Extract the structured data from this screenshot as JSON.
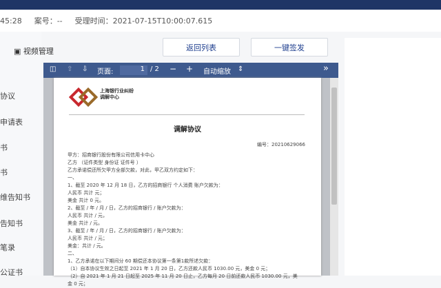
{
  "info": {
    "time_partial": "45:28",
    "case_no": "案号：--",
    "accept_time": "受理时间：2021-07-15T10:00:07.615"
  },
  "sidebar": {
    "video_label": "视频管理",
    "items": [
      "协议",
      "申请表",
      "书",
      "书",
      "维告知书",
      "告知书",
      "笔录",
      "公证书"
    ]
  },
  "buttons": {
    "back": "返回列表",
    "sign": "一键签发"
  },
  "toolbar": {
    "page_label": "页面:",
    "page_value": "1",
    "page_total": "/ 2",
    "zoom": "自动缩放",
    "minus": "−",
    "plus": "+",
    "more": "»"
  },
  "doc": {
    "logo_text": "上海银行业纠纷调解中心",
    "title": "调解协议",
    "number": "编号：20210629066",
    "lines": [
      "甲方：招商银行股份有限公司信用卡中心",
      "乙方            （证件类型    身份证 证件号                              ）",
      "乙方承诺偿还所欠甲方全部欠款，对此，甲乙双方约定如下：",
      "一、",
      "1、截至 2020 年 12 月 18 日，乙方的招商银行 个人消费 账户欠款为：",
      "人民币  共计        元；",
      "美金    共计    0     元。",
      "2、截至  /  年 / 月 / 日，乙方的招商银行     /     账户欠款为：",
      "人民币    共计     /      元，",
      "美金    共计     /     元。",
      "3、截至  /  年 / 月 / 日，乙方的招商银行     /     账户欠款为：",
      "人民币    共计     /     元；",
      "美金：共计     /    元。",
      "二、",
      "1、乙方承诺在以下期间分 60 期偿还本协议第一条第1款所述欠款：",
      "（1）自本协议生效之日起至 2021 年 1 月 20 日，乙方还款人民币  1030.00  元，美金  0 元；",
      "（2）自 2021 年 1 月 21 日起至 2025 年 11 月 20 日止，乙方每月 20 日前还款人民币 1030.00      元，美",
      "金 0 元；"
    ]
  },
  "colors": {
    "header": "#1f3566",
    "toolbar": "#3e5a8e",
    "button_text": "#1f3f8f"
  }
}
